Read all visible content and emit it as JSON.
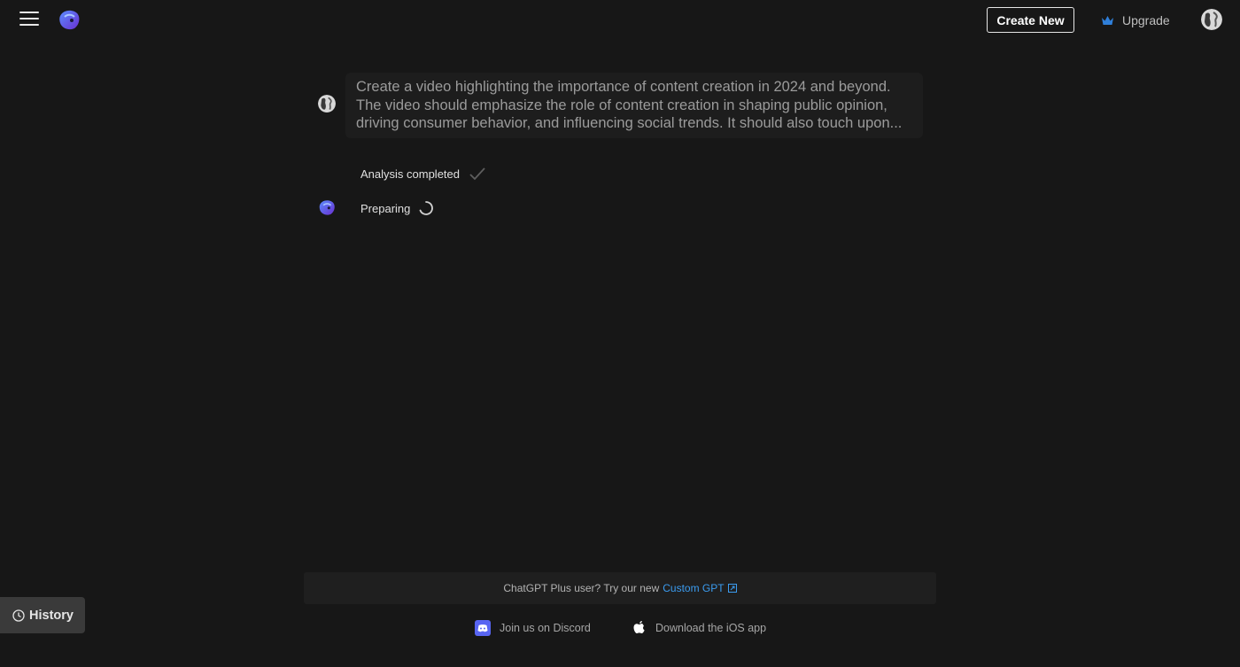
{
  "header": {
    "menu_icon": "hamburger-menu-icon",
    "logo_icon": "app-logo-icon",
    "create_new_label": "Create New",
    "upgrade_label": "Upgrade",
    "upgrade_icon": "crown-icon",
    "accent_color": "#2f7fd9"
  },
  "conversation": {
    "prompt_lines": [
      "Create a video highlighting the importance of content creation in 2024 and beyond.",
      "The video should emphasize the role of content creation in shaping public opinion,",
      "driving consumer behavior, and influencing social trends. It should also touch upon..."
    ],
    "status_completed": "Analysis completed",
    "status_preparing": "Preparing"
  },
  "promo": {
    "text": "ChatGPT Plus user? Try our new",
    "link_label": "Custom GPT",
    "link_color": "#3b9cf0"
  },
  "footer": {
    "discord_label": "Join us on Discord",
    "ios_label": "Download the iOS app"
  },
  "history": {
    "label": "History"
  }
}
